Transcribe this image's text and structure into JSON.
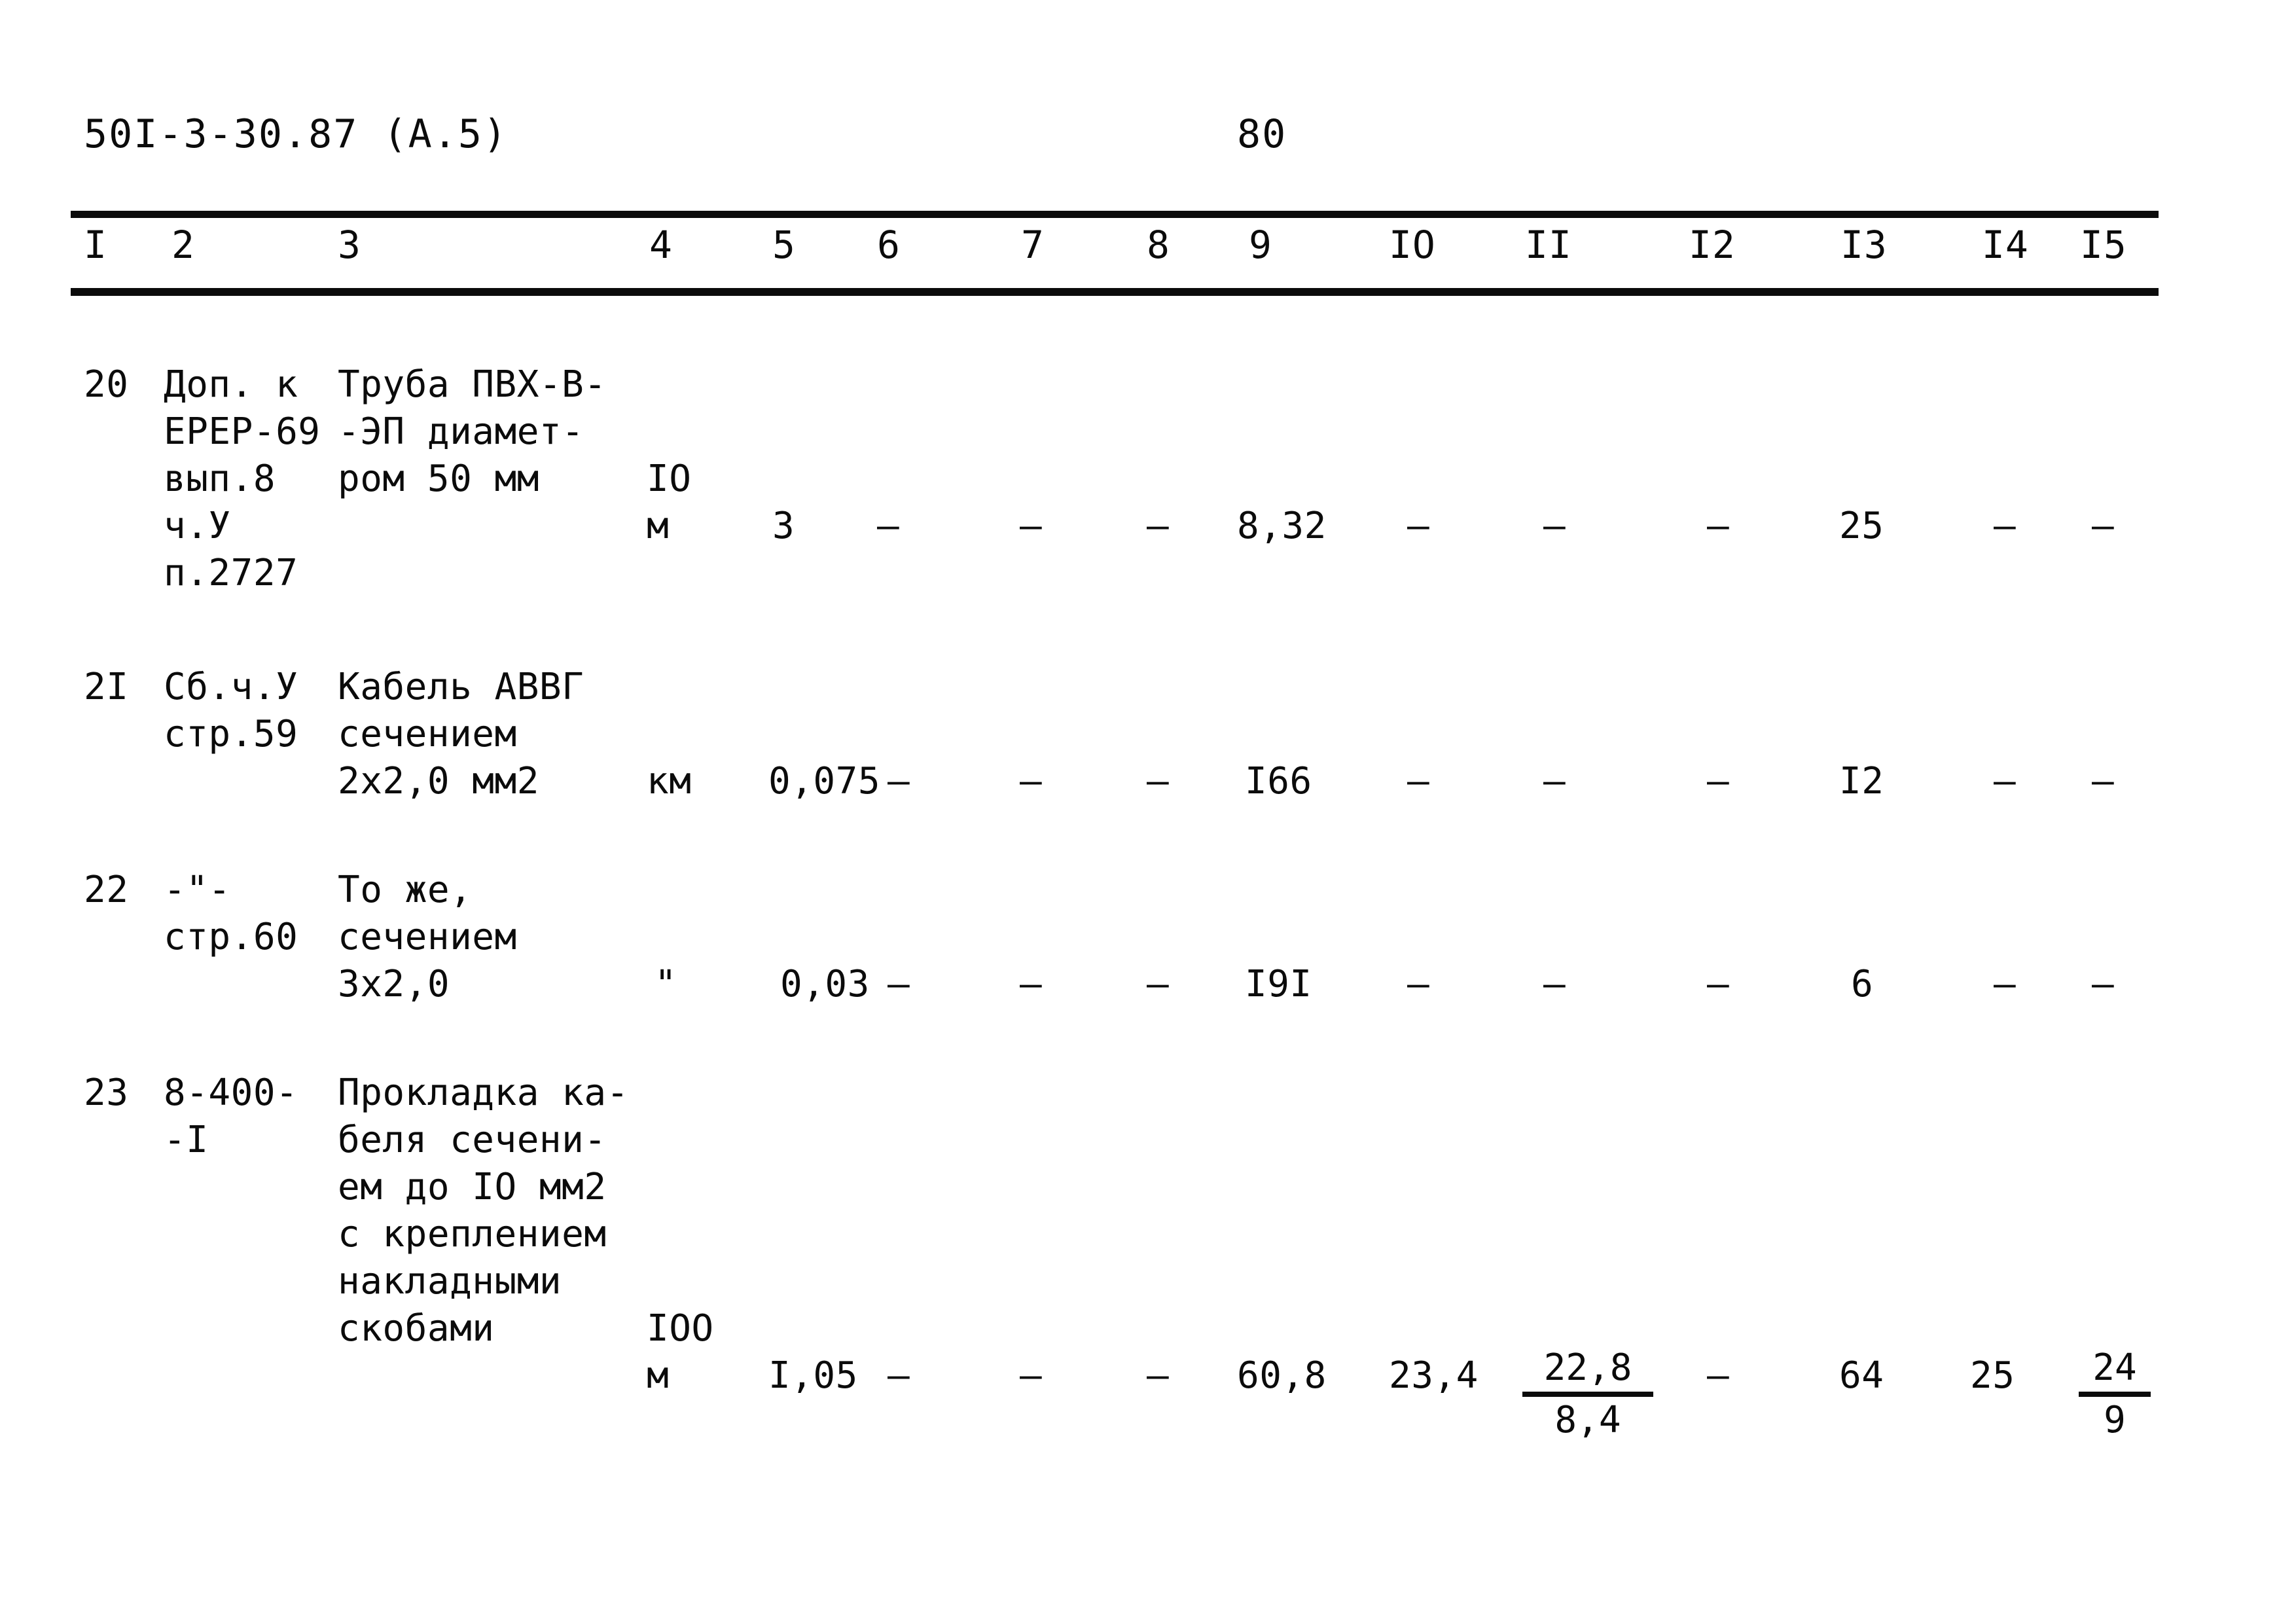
{
  "document": {
    "code": "50I-3-30.87 (А.5)",
    "page_number": "80"
  },
  "table": {
    "column_headers": [
      "I",
      "2",
      "3",
      "4",
      "5",
      "6",
      "7",
      "8",
      "9",
      "IO",
      "II",
      "I2",
      "I3",
      "I4",
      "I5"
    ],
    "rows": [
      {
        "num": "20",
        "source_lines": [
          "Доп. к",
          "ЕРЕР-69",
          "вып.8",
          "ч.У",
          "п.2727"
        ],
        "description_lines": [
          "Труба ПВХ-В-",
          "-ЭП диамет-",
          "ром 50 мм"
        ],
        "unit_top": "IO",
        "unit_bottom": "м",
        "c5": "3",
        "c6": "–",
        "c7": "–",
        "c8": "–",
        "c9": "8,32",
        "c10": "–",
        "c11": "–",
        "c12": "–",
        "c13": "25",
        "c14": "–",
        "c15": "–"
      },
      {
        "num": "2I",
        "source_lines": [
          "Сб.ч.У",
          "стр.59"
        ],
        "description_lines": [
          "Кабель АВВГ",
          "сечением",
          "2х2,0 мм2"
        ],
        "unit_top": "",
        "unit_bottom": "км",
        "c5": "0,075",
        "c6": "–",
        "c7": "–",
        "c8": "–",
        "c9": "I66",
        "c10": "–",
        "c11": "–",
        "c12": "–",
        "c13": "I2",
        "c14": "–",
        "c15": "–"
      },
      {
        "num": "22",
        "source_lines": [
          "-\"-",
          "стр.60"
        ],
        "description_lines": [
          "То же,",
          "сечением",
          "3х2,0"
        ],
        "unit_top": "",
        "unit_bottom": "\"",
        "c5": "0,03",
        "c6": "–",
        "c7": "–",
        "c8": "–",
        "c9": "I9I",
        "c10": "–",
        "c11": "–",
        "c12": "–",
        "c13": "6",
        "c14": "–",
        "c15": "–"
      },
      {
        "num": "23",
        "source_lines": [
          "8-400-",
          "-I"
        ],
        "description_lines": [
          "Прокладка ка-",
          "беля сечени-",
          "ем до IO мм2",
          "с креплением",
          "накладными",
          "скобами"
        ],
        "unit_top": "IOO",
        "unit_bottom": "м",
        "c5": "I,05",
        "c6": "–",
        "c7": "–",
        "c8": "–",
        "c9": "60,8",
        "c10": "23,4",
        "c11_frac_numerator": "22,8",
        "c11_frac_denominator": "8,4",
        "c12": "–",
        "c13": "64",
        "c14": "25",
        "c15_frac_numerator": "24",
        "c15_frac_denominator": "9"
      }
    ]
  }
}
